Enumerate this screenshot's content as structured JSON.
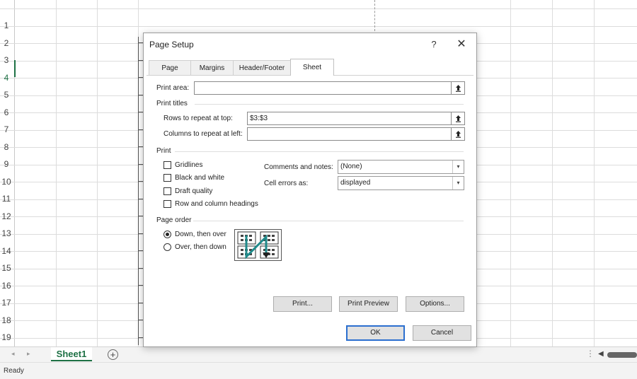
{
  "sheet": {
    "row_numbers": [
      "1",
      "2",
      "3",
      "4",
      "5",
      "6",
      "7",
      "8",
      "9",
      "10",
      "11",
      "12",
      "13",
      "14",
      "15",
      "16",
      "17",
      "18",
      "19"
    ],
    "active_row": "4"
  },
  "tabs_bar": {
    "sheet_tab": "Sheet1",
    "add_sheet": "+",
    "nav_prev": "◂",
    "nav_next": "▸",
    "more": "⋮",
    "scroll_left": "◀"
  },
  "status": {
    "text": "Ready"
  },
  "dialog": {
    "title": "Page Setup",
    "help": "?",
    "close": "✕",
    "tabs": [
      {
        "label": "Page",
        "selected": false
      },
      {
        "label": "Margins",
        "selected": false
      },
      {
        "label": "Header/Footer",
        "selected": false
      },
      {
        "label": "Sheet",
        "selected": true
      }
    ],
    "print_area": {
      "label": "Print area:",
      "value": ""
    },
    "print_titles": {
      "label": "Print titles",
      "rows_label": "Rows to repeat at top:",
      "rows_value": "$3:$3",
      "cols_label": "Columns to repeat at left:",
      "cols_value": ""
    },
    "print": {
      "label": "Print",
      "checkboxes": [
        {
          "label": "Gridlines",
          "checked": false
        },
        {
          "label": "Black and white",
          "checked": false
        },
        {
          "label": "Draft quality",
          "checked": false
        },
        {
          "label": "Row and column headings",
          "checked": false
        }
      ],
      "comments_label": "Comments and notes:",
      "comments_value": "(None)",
      "errors_label": "Cell errors as:",
      "errors_value": "displayed"
    },
    "page_order": {
      "label": "Page order",
      "options": [
        {
          "label": "Down, then over",
          "selected": true
        },
        {
          "label": "Over, then down",
          "selected": false
        }
      ]
    },
    "buttons": {
      "print": "Print...",
      "preview": "Print Preview",
      "options": "Options...",
      "ok": "OK",
      "cancel": "Cancel"
    },
    "colors": {
      "accent": "#2b6fcf",
      "arrow": "#1f8a8a"
    }
  }
}
